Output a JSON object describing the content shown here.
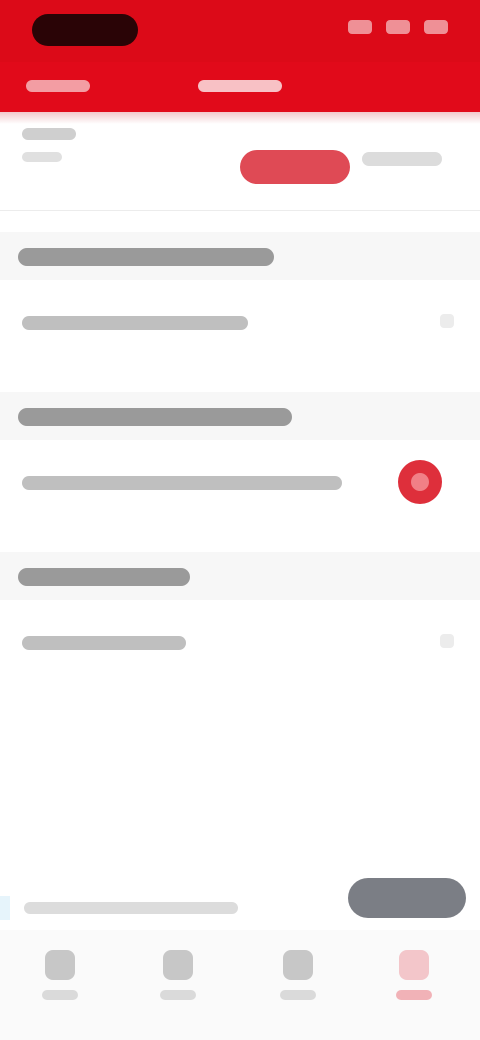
{
  "status_bar": {
    "time": "",
    "indicators": [
      "signal-icon",
      "wifi-icon",
      "battery-icon"
    ]
  },
  "header": {
    "tabs": [
      {
        "label": ""
      },
      {
        "label": ""
      }
    ],
    "active_tab": 1
  },
  "filter": {
    "label": "",
    "sublabel": "",
    "segments": [
      {
        "label": "",
        "active": true
      },
      {
        "label": "",
        "active": false
      }
    ]
  },
  "sections": [
    {
      "title": "",
      "rows": [
        {
          "label": "",
          "control": "chevron"
        }
      ]
    },
    {
      "title": "",
      "rows": [
        {
          "label": "",
          "control": "toggle-on"
        }
      ]
    },
    {
      "title": "",
      "rows": [
        {
          "label": "",
          "control": "chevron"
        }
      ]
    }
  ],
  "footer_note": {
    "text": "",
    "button_label": ""
  },
  "bottom_nav": {
    "items": [
      {
        "label": "",
        "icon": "home-icon"
      },
      {
        "label": "",
        "icon": "chat-icon"
      },
      {
        "label": "",
        "icon": "bell-icon"
      },
      {
        "label": "",
        "icon": "profile-icon",
        "active": true
      }
    ]
  },
  "colors": {
    "brand": "#dc0a18",
    "accent": "#df4a55",
    "toggle": "#de2f3b",
    "nav_active": "#f3c6ca"
  }
}
